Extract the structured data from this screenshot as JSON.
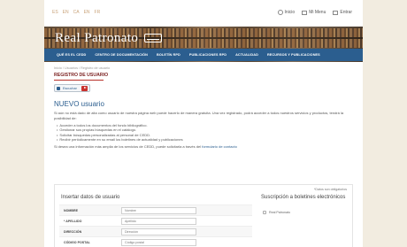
{
  "header": {
    "languages": [
      "ES",
      "EN",
      "CA",
      "EN",
      "FR"
    ],
    "links": [
      {
        "label": "Inicio",
        "icon": "home-icon"
      },
      {
        "label": "Mi Menu",
        "icon": "menu-icon"
      },
      {
        "label": "Entrar",
        "icon": "login-icon"
      }
    ],
    "logo_text": "Real Patronato"
  },
  "nav": {
    "items": [
      "QUÉ ES EL CEDD",
      "CENTRO DE DOCUMENTACIÓN",
      "BOLETÍN RPD",
      "PUBLICACIONES RPD",
      "ACTUALIDAD",
      "RECURSOS Y PUBLICACIONES"
    ],
    "accent": "#2b5e8f"
  },
  "content": {
    "breadcrumb": "Inicio / Usuarios / Registro de usuario",
    "page_title": "REGISTRO DE USUARIO",
    "listen_label": "Escuchar",
    "section_title": "NUEVO usuario",
    "intro": "Si aún no está dado de alta como usuario de nuestra página web puede hacerlo de manera gratuita. Una vez registrado, podrá acceder a todos nuestros servicios y productos, tendrá la posibilidad de:",
    "bullets": [
      "Acceder a todos los documentos del fondo bibliográfico.",
      "Gestionar sus propias búsquedas en el catálogo.",
      "Solicitar búsquedas personalizadas al personal de CEDD.",
      "Recibir periódicamente en su email los boletines de actualidad y publicaciones"
    ],
    "more_text": "Si desea una información más amplia de los servicios de CEDD, puede solicitarla a través del",
    "more_link": "formulario de contacto"
  },
  "form": {
    "required_note": "*Datos son obligatorios",
    "heading": "Insertar datos de usuario",
    "subscriptions_heading": "Suscripción a boletines electrónicos",
    "subscription_option": "Real Patronato",
    "fields": [
      {
        "label": "NOMBRE",
        "placeholder": "Nombre"
      },
      {
        "label": "* APELLIDO",
        "placeholder": "Apellido"
      },
      {
        "label": "DIRECCIÓN",
        "placeholder": "Dirección"
      },
      {
        "label": "CÓDIGO POSTAL",
        "placeholder": "Código postal"
      }
    ]
  }
}
